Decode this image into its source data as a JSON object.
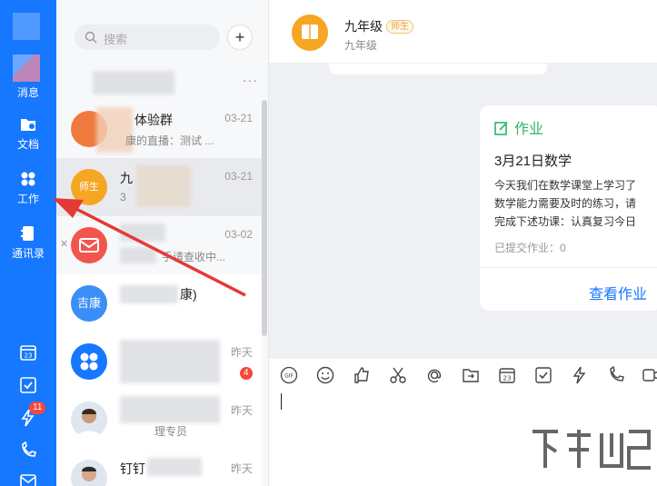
{
  "nav": {
    "items": [
      {
        "label": "消息",
        "icon": "message-icon"
      },
      {
        "label": "文档",
        "icon": "docs-icon"
      },
      {
        "label": "工作",
        "icon": "workbench-icon"
      },
      {
        "label": "通讯录",
        "icon": "contacts-icon"
      }
    ],
    "bottom": [
      {
        "icon": "calendar-icon"
      },
      {
        "icon": "todo-icon"
      },
      {
        "icon": "ding-icon",
        "badge": "11"
      },
      {
        "icon": "call-icon"
      },
      {
        "icon": "mail-icon"
      }
    ]
  },
  "list": {
    "search_placeholder": "搜索",
    "add_label": "+",
    "more_label": "···",
    "conversations": [
      {
        "title": "体验群",
        "snippet": "康的直播：测试 ...",
        "time": "03-21",
        "avatar_color": "#f07a3d"
      },
      {
        "title": "九",
        "snippet": "3",
        "time": "03-21",
        "avatar_text": "师生",
        "avatar_color": "#f5a623"
      },
      {
        "title": "",
        "snippet": "手请查收中...",
        "time": "03-02",
        "avatar_color": "#f2554b"
      },
      {
        "title": "康)",
        "snippet": "",
        "time": "",
        "avatar_text": "吉康",
        "avatar_color": "#3a8ef6"
      },
      {
        "title": "",
        "snippet": "",
        "time": "昨天",
        "badge": "4",
        "avatar_color": "#1677ff"
      },
      {
        "title": "",
        "snippet": "理专员",
        "time": "昨天",
        "avatar_color": "#dfe6ef"
      },
      {
        "title": "钉钉",
        "snippet": "",
        "time": "昨天",
        "avatar_color": "#dfe6ef"
      }
    ]
  },
  "chat": {
    "name": "九年级",
    "tag": "师生",
    "sub": "九年级",
    "card": {
      "header": "作业",
      "title": "3月21日数学",
      "body_lines": [
        "今天我们在数学课堂上学习了",
        "数学能力需要及时的练习，请",
        "完成下述功课：认真复习今日"
      ],
      "submitted": "已提交作业：0",
      "link": "查看作业"
    },
    "toolbar": [
      "gif-icon",
      "emoji-icon",
      "thumbs-up-icon",
      "scissors-icon",
      "at-icon",
      "folder-icon",
      "calendar-icon",
      "todo-icon",
      "ding-icon",
      "call-icon",
      "video-icon"
    ],
    "gif_label": "GIF"
  },
  "colors": {
    "accent": "#1677ff",
    "arrow": "#e53935",
    "homework": "#2fb36b"
  }
}
